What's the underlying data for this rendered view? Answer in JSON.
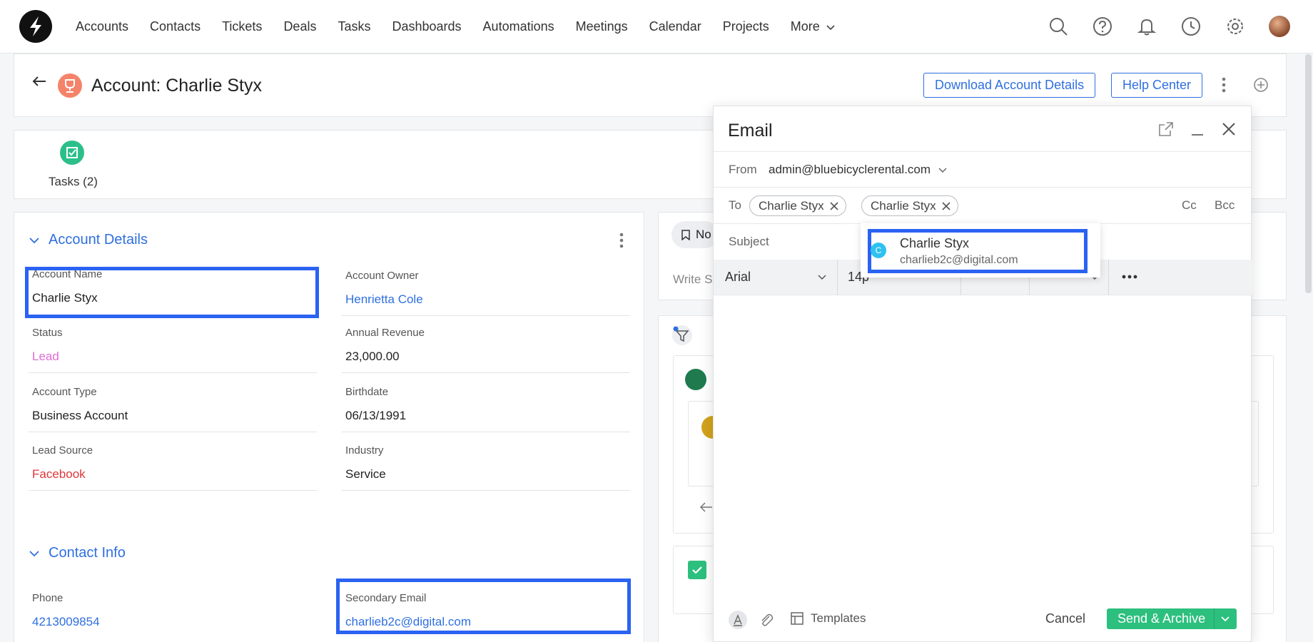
{
  "nav": {
    "items": [
      "Accounts",
      "Contacts",
      "Tickets",
      "Deals",
      "Tasks",
      "Dashboards",
      "Automations",
      "Meetings",
      "Calendar",
      "Projects"
    ],
    "more_label": "More"
  },
  "header": {
    "title": "Account: Charlie Styx",
    "download_label": "Download Account Details",
    "help_label": "Help Center"
  },
  "tasks": {
    "label": "Tasks (2)"
  },
  "details": {
    "section_account": "Account Details",
    "section_contact": "Contact Info",
    "fields": {
      "account_name": {
        "label": "Account Name",
        "value": "Charlie Styx"
      },
      "account_owner": {
        "label": "Account Owner",
        "value": "Henrietta Cole"
      },
      "status": {
        "label": "Status",
        "value": "Lead"
      },
      "annual_revenue": {
        "label": "Annual Revenue",
        "value": "23,000.00"
      },
      "account_type": {
        "label": "Account Type",
        "value": "Business Account"
      },
      "birthdate": {
        "label": "Birthdate",
        "value": "06/13/1991"
      },
      "lead_source": {
        "label": "Lead Source",
        "value": "Facebook"
      },
      "industry": {
        "label": "Industry",
        "value": "Service"
      },
      "phone": {
        "label": "Phone",
        "value": "4213009854"
      },
      "secondary_email": {
        "label": "Secondary Email",
        "value": "charlieb2c@digital.com"
      }
    }
  },
  "note": {
    "chip": "No",
    "write_placeholder": "Write S"
  },
  "email": {
    "title": "Email",
    "from_label": "From",
    "from_value": "admin@bluebicyclerental.com",
    "to_label": "To",
    "recipients": [
      "Charlie Styx",
      "Charlie Styx"
    ],
    "cc_label": "Cc",
    "bcc_label": "Bcc",
    "subject_label": "Subject",
    "font": "Arial",
    "font_size": "14p",
    "templates_label": "Templates",
    "cancel_label": "Cancel",
    "send_label": "Send & Archive"
  },
  "suggestion": {
    "initial": "C",
    "name": "Charlie Styx",
    "email": "charlieb2c@digital.com"
  },
  "colors": {
    "accent": "#2f6fe0",
    "highlight": "#2a62f2",
    "send": "#2dbf7e"
  }
}
